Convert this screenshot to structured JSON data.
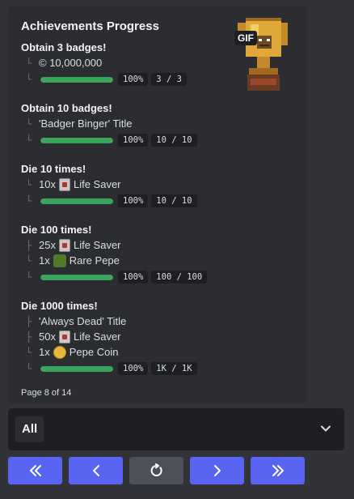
{
  "embed": {
    "title": "Achievements Progress",
    "thumbnail_badge": "GIF",
    "achievements": [
      {
        "title": "Obtain 3 badges!",
        "rewards": [
          {
            "text": "© 10,000,000"
          }
        ],
        "progress_fraction": 1.0,
        "percent": "100%",
        "count": "3 / 3"
      },
      {
        "title": "Obtain 10 badges!",
        "rewards": [
          {
            "text": "'Badger Binger' Title"
          }
        ],
        "progress_fraction": 1.0,
        "percent": "100%",
        "count": "10 / 10"
      },
      {
        "title": "Die 10 times!",
        "rewards": [
          {
            "qty": "10x",
            "icon": "life-saver-icon",
            "text": "Life Saver"
          }
        ],
        "progress_fraction": 1.0,
        "percent": "100%",
        "count": "10 / 10"
      },
      {
        "title": "Die 100 times!",
        "rewards": [
          {
            "qty": "25x",
            "icon": "life-saver-icon",
            "text": "Life Saver"
          },
          {
            "qty": "1x",
            "icon": "rare-pepe-icon",
            "text": "Rare Pepe"
          }
        ],
        "progress_fraction": 1.0,
        "percent": "100%",
        "count": "100 / 100"
      },
      {
        "title": "Die 1000 times!",
        "rewards": [
          {
            "text": "'Always Dead' Title"
          },
          {
            "qty": "50x",
            "icon": "life-saver-icon",
            "text": "Life Saver"
          },
          {
            "qty": "1x",
            "icon": "pepe-coin-icon",
            "text": "Pepe Coin"
          }
        ],
        "progress_fraction": 1.0,
        "percent": "100%",
        "count": "1K / 1K"
      }
    ],
    "footer": "Page 8 of 14"
  },
  "select": {
    "value": "All"
  },
  "buttons": [
    {
      "name": "first-page-button",
      "icon": "double-chevron-left-icon",
      "style": "primary"
    },
    {
      "name": "previous-page-button",
      "icon": "chevron-left-icon",
      "style": "primary"
    },
    {
      "name": "refresh-button",
      "icon": "refresh-icon",
      "style": "secondary"
    },
    {
      "name": "next-page-button",
      "icon": "chevron-right-icon",
      "style": "primary"
    },
    {
      "name": "last-page-button",
      "icon": "double-chevron-right-icon",
      "style": "primary"
    }
  ],
  "colors": {
    "accent": "#5865f2",
    "progress": "#3ba55d",
    "background": "#313338",
    "embed": "#2b2d31"
  }
}
